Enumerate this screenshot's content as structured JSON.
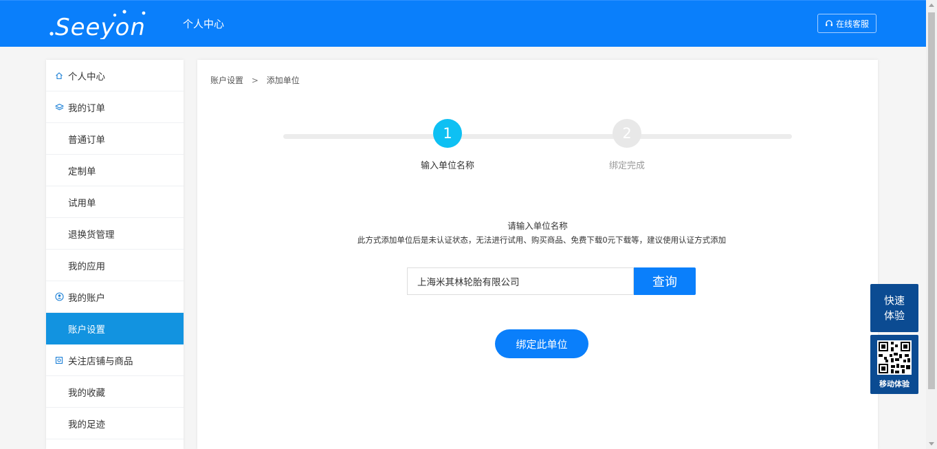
{
  "header": {
    "logo_text": "Seeyon",
    "title": "个人中心",
    "service_label": "在线客服",
    "brand_color": "#0a7ffb"
  },
  "sidebar": {
    "items": [
      {
        "label": "个人中心",
        "icon": "home-icon"
      },
      {
        "label": "我的订单",
        "icon": "layers-icon"
      },
      {
        "label": "普通订单"
      },
      {
        "label": "定制单"
      },
      {
        "label": "试用单"
      },
      {
        "label": "退换货管理"
      },
      {
        "label": "我的应用"
      },
      {
        "label": "我的账户",
        "icon": "user-circle-icon"
      },
      {
        "label": "账户设置",
        "active": true
      },
      {
        "label": "关注店铺与商品",
        "icon": "shop-icon"
      },
      {
        "label": "我的收藏"
      },
      {
        "label": "我的足迹"
      }
    ],
    "active_color": "#1293e0"
  },
  "breadcrumb": {
    "parent": "账户设置",
    "separator": ">",
    "current": "添加单位"
  },
  "steps": [
    {
      "number": "1",
      "label": "输入单位名称",
      "state": "active",
      "color": "#0ec0f3"
    },
    {
      "number": "2",
      "label": "绑定完成",
      "state": "inactive",
      "color": "#e8e8e8"
    }
  ],
  "form": {
    "prompt_title": "请输入单位名称",
    "prompt_note": "此方式添加单位后是未认证状态，无法进行试用、购买商品、免费下载0元下载等，建议使用认证方式添加",
    "input_value": "上海米其林轮胎有限公司",
    "search_label": "查询",
    "bind_label": "绑定此单位"
  },
  "floating": {
    "trial_line1": "快速",
    "trial_line2": "体验",
    "mobile_label": "移动体验",
    "color": "#0b4b92"
  }
}
